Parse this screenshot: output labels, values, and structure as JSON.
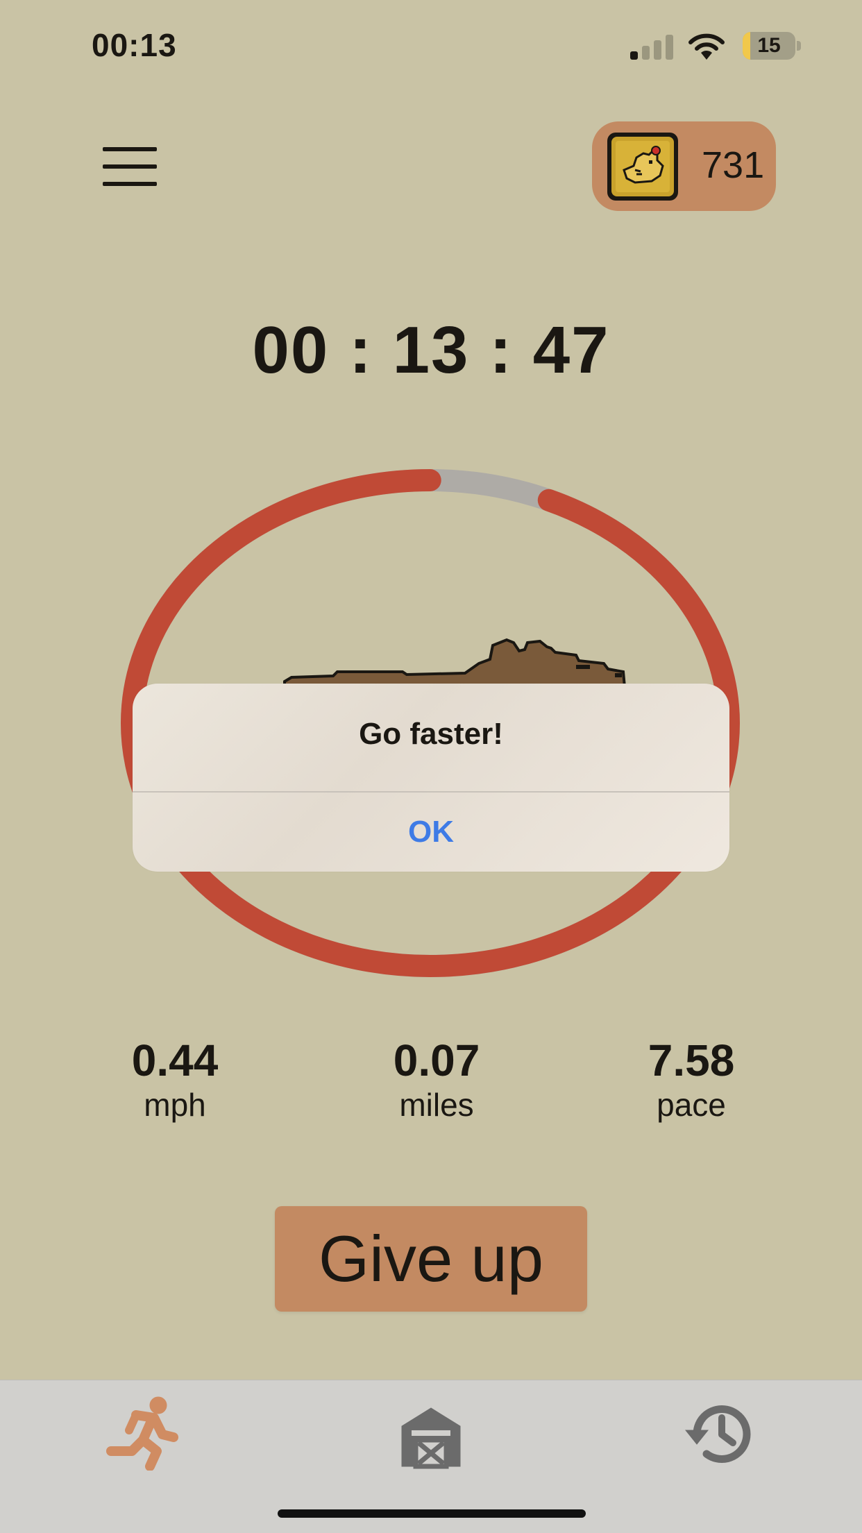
{
  "status_bar": {
    "time": "00:13",
    "battery_level": 15,
    "battery_text": "15",
    "signal_bars_active": 1,
    "signal_bars_total": 4
  },
  "header": {
    "menu_icon": "hamburger-menu-icon",
    "coin_icon": "chicken-coin-icon",
    "coin_count": "731"
  },
  "timer": {
    "display": "00 : 13 : 47"
  },
  "progress_ring": {
    "progress_color": "#c04a36",
    "track_color": "#aeaba6",
    "gap_start_fraction": 0.0,
    "gap_end_fraction": 0.065
  },
  "stats": [
    {
      "value": "0.44",
      "label": "mph"
    },
    {
      "value": "0.07",
      "label": "miles"
    },
    {
      "value": "7.58",
      "label": "pace"
    }
  ],
  "actions": {
    "give_up_label": "Give up"
  },
  "tab_bar": {
    "tabs": [
      {
        "icon": "running-person-icon",
        "active": true,
        "color": "#d08c62"
      },
      {
        "icon": "barn-icon",
        "active": false,
        "color": "#6b6b6b"
      },
      {
        "icon": "history-icon",
        "active": false,
        "color": "#6b6b6b"
      }
    ]
  },
  "alert": {
    "title": "Go faster!",
    "ok_label": "OK"
  },
  "colors": {
    "background": "#c9c3a5",
    "accent": "#c38a62",
    "alert_button": "#3e7be6"
  }
}
